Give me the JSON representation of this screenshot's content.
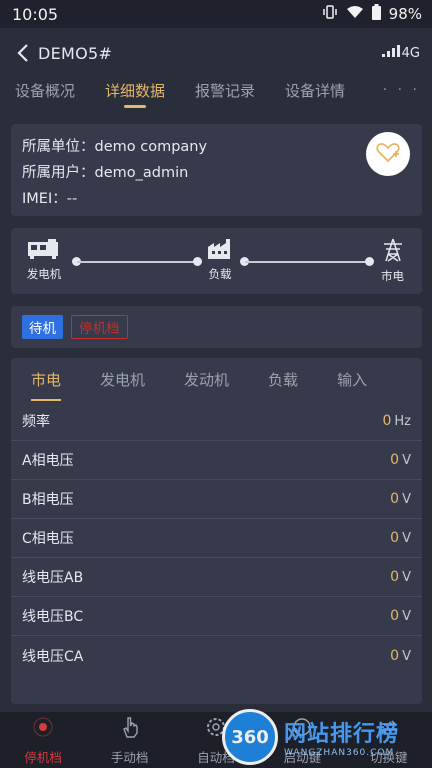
{
  "status_bar": {
    "time": "10:05",
    "battery": "98%"
  },
  "header": {
    "title": "DEMO5#",
    "network": "4G"
  },
  "tabs": [
    {
      "label": "设备概况",
      "active": false
    },
    {
      "label": "详细数据",
      "active": true
    },
    {
      "label": "报警记录",
      "active": false
    },
    {
      "label": "设备详情",
      "active": false
    }
  ],
  "tabs_more": "· · ·",
  "info": {
    "unit_line": "所属单位：demo company",
    "user_line": "所属用户：demo_admin",
    "imei_line": "IMEI：--"
  },
  "flow": {
    "generator": "发电机",
    "load": "负载",
    "mains": "市电"
  },
  "mode": {
    "standby": "待机",
    "stopped": "停机档"
  },
  "sub_tabs": [
    {
      "label": "市电",
      "active": true
    },
    {
      "label": "发电机",
      "active": false
    },
    {
      "label": "发动机",
      "active": false
    },
    {
      "label": "负载",
      "active": false
    },
    {
      "label": "输入",
      "active": false
    }
  ],
  "rows": [
    {
      "label": "频率",
      "value": "0",
      "unit": "Hz"
    },
    {
      "label": "A相电压",
      "value": "0",
      "unit": "V"
    },
    {
      "label": "B相电压",
      "value": "0",
      "unit": "V"
    },
    {
      "label": "C相电压",
      "value": "0",
      "unit": "V"
    },
    {
      "label": "线电压AB",
      "value": "0",
      "unit": "V"
    },
    {
      "label": "线电压BC",
      "value": "0",
      "unit": "V"
    },
    {
      "label": "线电压CA",
      "value": "0",
      "unit": "V"
    }
  ],
  "bottom_nav": [
    {
      "label": "停机档",
      "icon": "stop-icon",
      "active": true
    },
    {
      "label": "手动档",
      "icon": "hand-icon",
      "active": false
    },
    {
      "label": "自动档",
      "icon": "gear-icon",
      "active": false
    },
    {
      "label": "启动键",
      "icon": "start-icon",
      "active": false
    },
    {
      "label": "切换键",
      "icon": "switch-icon",
      "active": false
    }
  ],
  "watermark": {
    "badge": "360",
    "main": "网站排行榜",
    "sub": "WANGZHAN360.COM"
  },
  "colors": {
    "accent": "#e4b769",
    "standby": "#2f6fe0",
    "stop": "#c0302c",
    "card": "#363a4a"
  }
}
